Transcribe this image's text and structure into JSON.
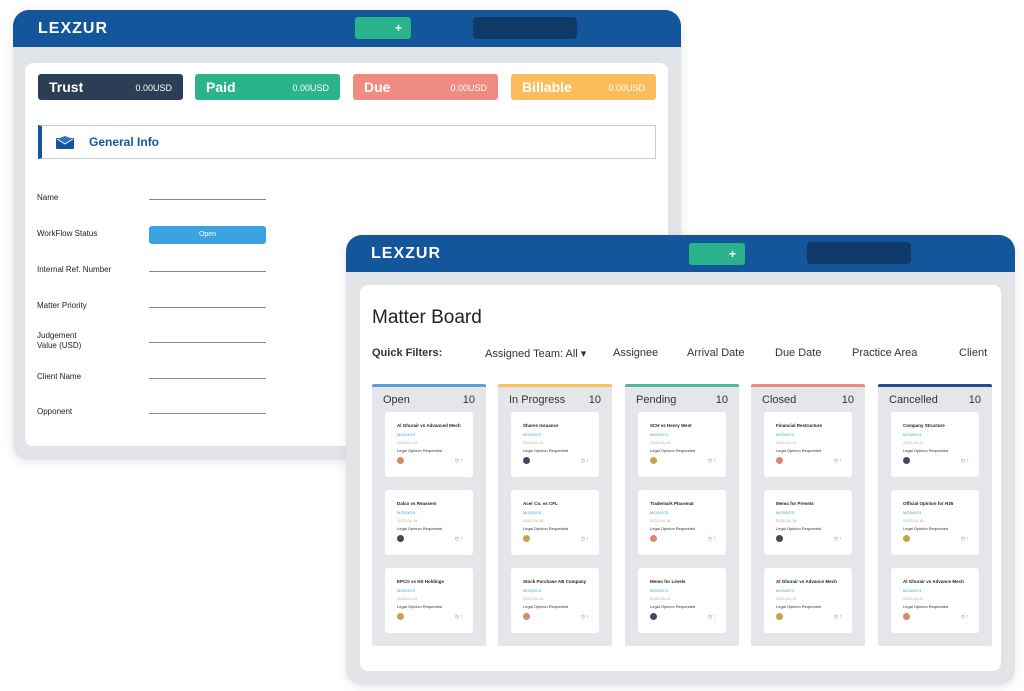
{
  "colors": {
    "brand": "#14569c",
    "green": "#2bb38c",
    "trust": "#2c3e55",
    "due": "#ef8b81",
    "billable": "#fbbd5b",
    "status": "#3aa3e0"
  },
  "matter_window": {
    "logo": "LEXZUR",
    "add_button": "+",
    "tiles": [
      {
        "label": "Trust",
        "value": "0.00USD"
      },
      {
        "label": "Paid",
        "value": "0.00USD"
      },
      {
        "label": "Due",
        "value": "0.00USD"
      },
      {
        "label": "Billable",
        "value": "0.00USD"
      }
    ],
    "section_title": "General Info",
    "section_icon": "envelope-icon",
    "fields": [
      {
        "label": "Name"
      },
      {
        "label": "WorkFlow Status",
        "value": "Open"
      },
      {
        "label": "Internal Ref. Number"
      },
      {
        "label": "Matter Priority"
      },
      {
        "label": "Judgement Value (USD)"
      },
      {
        "label": "Client Name"
      },
      {
        "label": "Opponent"
      }
    ]
  },
  "board_window": {
    "logo": "LEXZUR",
    "add_button": "+",
    "title": "Matter Board",
    "filters": {
      "label": "Quick Filters:",
      "items": [
        "Assigned Team: All ▾",
        "Assignee",
        "Arrival Date",
        "Due Date",
        "Practice Area",
        "Client"
      ]
    },
    "columns": [
      {
        "name": "Open",
        "count": "10",
        "cards": [
          {
            "title": "Al Ghurair vs Advanced Mech",
            "id": "MOD0074",
            "date": "2022-04-12",
            "desc": "Legal Opinion Requested"
          },
          {
            "title": "Dalco vs Reassem",
            "id": "MOD0075",
            "date": "2022-04-18",
            "desc": "Legal Opinion Requested"
          },
          {
            "title": "EPCO vs HS Holdings",
            "id": "MOD0074",
            "date": "2022-04-12",
            "desc": "Legal Opinion Requested"
          }
        ]
      },
      {
        "name": "In Progress",
        "count": "10",
        "cards": [
          {
            "title": "Shares Issuance",
            "id": "MOD0074",
            "date": "2022-04-12",
            "desc": "Legal Opinion Requested"
          },
          {
            "title": "Acer Co. vs CFL",
            "id": "MOD0075",
            "date": "2022-04-18",
            "desc": "Legal Opinion Requested"
          },
          {
            "title": "Stock Purchase AB Company",
            "id": "MOD0074",
            "date": "2022-04-12",
            "desc": "Legal Opinion Requested"
          }
        ]
      },
      {
        "name": "Pending",
        "count": "10",
        "cards": [
          {
            "title": "SCH vs Henry West",
            "id": "MOD0074",
            "date": "2022-04-12",
            "desc": "Legal Opinion Requested"
          },
          {
            "title": "Trademark Placemat",
            "id": "MOD0075",
            "date": "2022-04-18",
            "desc": "Legal Opinion Requested"
          },
          {
            "title": "Memo for Levels",
            "id": "MOD0074",
            "date": "2022-04-12",
            "desc": "Legal Opinion Requested"
          }
        ]
      },
      {
        "name": "Closed",
        "count": "10",
        "cards": [
          {
            "title": "Financial Restructure",
            "id": "MOD0074",
            "date": "2022-04-12",
            "desc": "Legal Opinion Requested"
          },
          {
            "title": "Memo for Presets",
            "id": "MOD0075",
            "date": "2022-04-18",
            "desc": "Legal Opinion Requested"
          },
          {
            "title": "Al Ghurair vs Advance Mech",
            "id": "MOD0074",
            "date": "2022-04-12",
            "desc": "Legal Opinion Requested"
          }
        ]
      },
      {
        "name": "Cancelled",
        "count": "10",
        "cards": [
          {
            "title": "Company Structure",
            "id": "MOD0074",
            "date": "2022-04-12",
            "desc": "Legal Opinion Requested"
          },
          {
            "title": "Official Opinion for H35",
            "id": "MOD0075",
            "date": "2022-04-18",
            "desc": "Legal Opinion Requested"
          },
          {
            "title": "Al Ghurair vs Advance Mech",
            "id": "MOD0074",
            "date": "2022-04-12",
            "desc": "Legal Opinion Requested"
          }
        ]
      }
    ]
  }
}
